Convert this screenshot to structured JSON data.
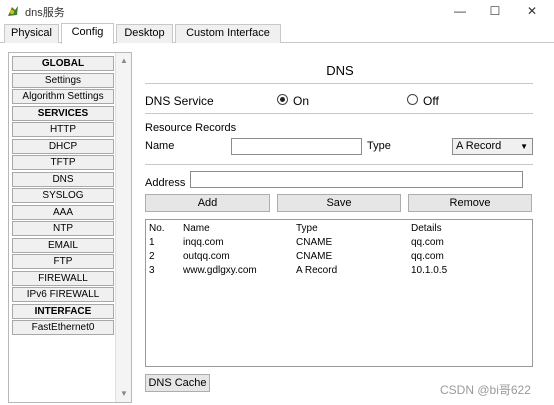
{
  "window": {
    "title": "dns服务",
    "minimize_glyph": "—",
    "maximize_glyph": "☐",
    "close_glyph": "✕"
  },
  "tabs": [
    {
      "label": "Physical",
      "active": false
    },
    {
      "label": "Config",
      "active": true
    },
    {
      "label": "Desktop",
      "active": false
    },
    {
      "label": "Custom Interface",
      "active": false
    }
  ],
  "nav": {
    "items": [
      {
        "label": "GLOBAL",
        "header": true
      },
      {
        "label": "Settings",
        "header": false
      },
      {
        "label": "Algorithm Settings",
        "header": false
      },
      {
        "label": "SERVICES",
        "header": true
      },
      {
        "label": "HTTP",
        "header": false
      },
      {
        "label": "DHCP",
        "header": false
      },
      {
        "label": "TFTP",
        "header": false
      },
      {
        "label": "DNS",
        "header": false
      },
      {
        "label": "SYSLOG",
        "header": false
      },
      {
        "label": "AAA",
        "header": false
      },
      {
        "label": "NTP",
        "header": false
      },
      {
        "label": "EMAIL",
        "header": false
      },
      {
        "label": "FTP",
        "header": false
      },
      {
        "label": "FIREWALL",
        "header": false
      },
      {
        "label": "IPv6 FIREWALL",
        "header": false
      },
      {
        "label": "INTERFACE",
        "header": true
      },
      {
        "label": "FastEthernet0",
        "header": false
      }
    ]
  },
  "dns": {
    "title": "DNS",
    "service_label": "DNS Service",
    "on_label": "On",
    "off_label": "Off",
    "service_state": "On",
    "resource_records_label": "Resource Records",
    "name_label": "Name",
    "name_value": "",
    "type_label": "Type",
    "type_value": "A Record",
    "address_label": "Address",
    "address_value": "",
    "add_label": "Add",
    "save_label": "Save",
    "remove_label": "Remove",
    "cache_label": "DNS Cache"
  },
  "records": {
    "headers": [
      "No.",
      "Name",
      "Type",
      "Details"
    ],
    "rows": [
      [
        "1",
        "inqq.com",
        "CNAME",
        "qq.com"
      ],
      [
        "2",
        "outqq.com",
        "CNAME",
        "qq.com"
      ],
      [
        "3",
        "www.gdlgxy.com",
        "A Record",
        "10.1.0.5"
      ]
    ]
  },
  "watermark": "CSDN @bi哥622"
}
